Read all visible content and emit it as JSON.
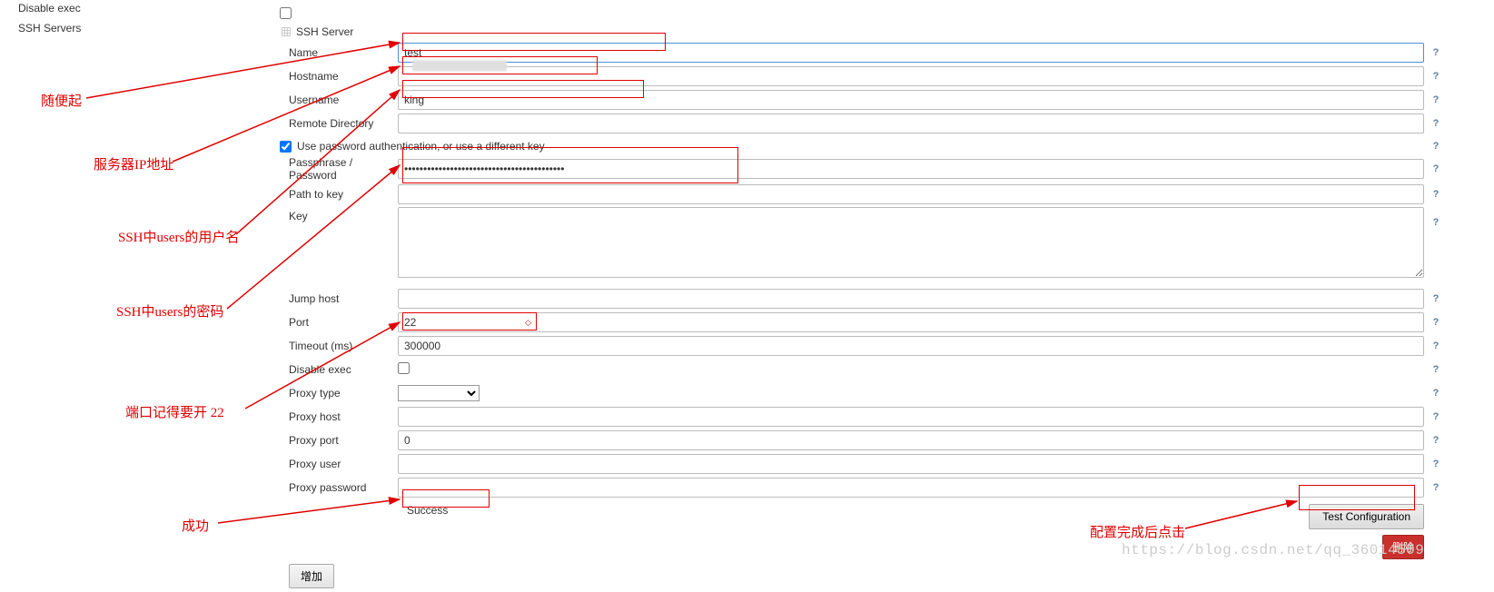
{
  "left": {
    "disable_exec_label": "Disable exec",
    "ssh_servers_label": "SSH Servers"
  },
  "section": {
    "header": "SSH Server"
  },
  "fields": {
    "name_label": "Name",
    "name_value": "test",
    "hostname_label": "Hostname",
    "hostname_value": "",
    "username_label": "Username",
    "username_value": "king",
    "remote_dir_label": "Remote Directory",
    "remote_dir_value": "",
    "use_pw_label": "Use password authentication, or use a different key",
    "use_pw_checked": true,
    "passphrase_label": "Passphrase / Password",
    "passphrase_value": "••••••••••••••••••••••••••••••••••••••••••",
    "path_key_label": "Path to key",
    "path_key_value": "",
    "key_label": "Key",
    "key_value": "",
    "jump_host_label": "Jump host",
    "jump_host_value": "",
    "port_label": "Port",
    "port_value": "22",
    "timeout_label": "Timeout (ms)",
    "timeout_value": "300000",
    "disable_exec2_label": "Disable exec",
    "disable_exec2_checked": false,
    "proxy_type_label": "Proxy type",
    "proxy_type_value": "",
    "proxy_host_label": "Proxy host",
    "proxy_host_value": "",
    "proxy_port_label": "Proxy port",
    "proxy_port_value": "0",
    "proxy_user_label": "Proxy user",
    "proxy_user_value": "",
    "proxy_pw_label": "Proxy password",
    "proxy_pw_value": ""
  },
  "status": {
    "text": "Success"
  },
  "buttons": {
    "test": "Test Configuration",
    "delete": "删除",
    "add": "增加"
  },
  "annotations": {
    "name": "随便起",
    "hostname": "服务器IP地址",
    "username": "SSH中users的用户名",
    "password": "SSH中users的密码",
    "port": "端口记得要开 22",
    "success": "成功",
    "test": "配置完成后点击"
  },
  "watermark": "https://blog.csdn.net/qq_36014509"
}
